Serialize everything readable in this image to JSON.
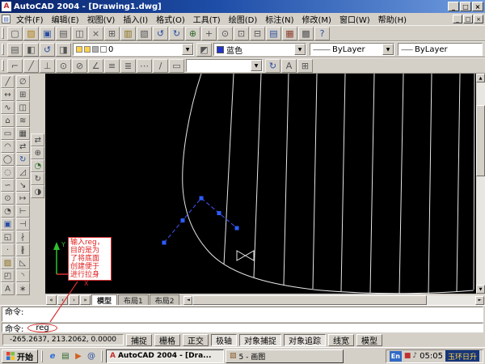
{
  "ui": {
    "dropdown_arrow": "▼",
    "scroll_up": "▲",
    "scroll_down": "▼",
    "scroll_left": "◄",
    "scroll_right": "►"
  },
  "window": {
    "app_icon": "A",
    "title": "AutoCAD 2004 - [Drawing1.dwg]",
    "min": "_",
    "max": "□",
    "close": "×"
  },
  "menu": {
    "items": [
      "文件(F)",
      "编辑(E)",
      "视图(V)",
      "插入(I)",
      "格式(O)",
      "工具(T)",
      "绘图(D)",
      "标注(N)",
      "修改(M)",
      "窗口(W)",
      "帮助(H)"
    ]
  },
  "toolbars": {
    "standard": [
      {
        "n": "new-file-icon",
        "g": "▢",
        "s": "color:#555"
      },
      {
        "n": "open-file-icon",
        "g": "▨",
        "s": "color:#b07d10"
      },
      {
        "n": "save-file-icon",
        "g": "▣",
        "s": "color:#2b4fa0"
      },
      {
        "n": "plot-icon",
        "g": "▤",
        "s": "color:#555"
      },
      {
        "n": "plot-preview-icon",
        "g": "◫",
        "s": "color:#555"
      },
      {
        "n": "cut-icon",
        "g": "×",
        "s": "color:#555"
      },
      {
        "n": "copy-icon",
        "g": "⊞",
        "s": "color:#555"
      },
      {
        "n": "paste-icon",
        "g": "▥",
        "s": "color:#8a6d1a"
      },
      {
        "n": "match-properties-icon",
        "g": "▧",
        "s": "color:#555"
      },
      {
        "n": "undo-icon",
        "g": "↺",
        "s": "color:#2b4fa0"
      },
      {
        "n": "redo-icon",
        "g": "↻",
        "s": "color:#2b4fa0"
      },
      {
        "n": "insert-hyperlink-icon",
        "g": "⊕",
        "s": "color:#2b6a2b"
      },
      {
        "n": "pan-realtime-icon",
        "g": "+",
        "s": "color:#555"
      },
      {
        "n": "zoom-realtime-icon",
        "g": "⊙",
        "s": "color:#555"
      },
      {
        "n": "zoom-window-icon",
        "g": "⊡",
        "s": "color:#555"
      },
      {
        "n": "zoom-previous-icon",
        "g": "⊟",
        "s": "color:#555"
      },
      {
        "n": "properties-icon",
        "g": "▤",
        "s": "color:#2b4fa0"
      },
      {
        "n": "design-center-icon",
        "g": "▦",
        "s": "color:#8a3d2a"
      },
      {
        "n": "tool-palettes-icon",
        "g": "▩",
        "s": "color:#555"
      },
      {
        "n": "help-icon",
        "g": "?",
        "s": "color:#2b4fa0"
      }
    ],
    "properties": {
      "icons": [
        {
          "n": "layer-properties-icon",
          "g": "▤",
          "s": "color:#555"
        },
        {
          "n": "layer-states-icon",
          "g": "◧",
          "s": "color:#555"
        },
        {
          "n": "layer-previous-icon",
          "g": "↺",
          "s": "color:#2b4fa0"
        },
        {
          "n": "make-layer-current-icon",
          "g": "◨",
          "s": "color:#555"
        }
      ],
      "mid_icon": {
        "n": "layer-tools-icon",
        "g": "◩"
      },
      "layer_value": "0",
      "color_value": "蓝色",
      "color_swatch_style": "background:#2233cc",
      "linetype_value": "ByLayer",
      "lineweight_value": "ByLayer"
    },
    "styles": {
      "icons": [
        {
          "n": "linear-dimension-icon",
          "g": "⌐",
          "s": "color:#555"
        },
        {
          "n": "aligned-dimension-icon",
          "g": "╱",
          "s": "color:#555"
        },
        {
          "n": "ordinate-dimension-icon",
          "g": "⊥",
          "s": "color:#555"
        },
        {
          "n": "radius-dimension-icon",
          "g": "⊙",
          "s": "color:#555"
        },
        {
          "n": "diameter-dimension-icon",
          "g": "⊘",
          "s": "color:#555"
        },
        {
          "n": "angular-dimension-icon",
          "g": "∠",
          "s": "color:#555"
        },
        {
          "n": "quick-dimension-icon",
          "g": "≡",
          "s": "color:#555"
        },
        {
          "n": "baseline-dimension-icon",
          "g": "≣",
          "s": "color:#555"
        },
        {
          "n": "continue-dimension-icon",
          "g": "⋯",
          "s": "color:#555"
        },
        {
          "n": "dimension-edit-icon",
          "g": "∕",
          "s": "color:#555"
        },
        {
          "n": "dimension-style-icon",
          "g": "▭",
          "s": "color:#555"
        }
      ],
      "style_value": "",
      "icons_after": [
        {
          "n": "dimension-update-icon",
          "g": "↻",
          "s": "color:#2b4fa0"
        },
        {
          "n": "dimension-text-edit-icon",
          "g": "A",
          "s": "color:#555"
        },
        {
          "n": "tolerance-icon",
          "g": "⊞",
          "s": "color:#555"
        }
      ]
    },
    "draw": [
      {
        "n": "line-icon",
        "g": "╱",
        "s": "color:#444"
      },
      {
        "n": "construction-line-icon",
        "g": "↔",
        "s": "color:#444"
      },
      {
        "n": "polyline-icon",
        "g": "∿",
        "s": "color:#444"
      },
      {
        "n": "polygon-icon",
        "g": "⌂",
        "s": "color:#444"
      },
      {
        "n": "rectangle-icon",
        "g": "▭",
        "s": "color:#444"
      },
      {
        "n": "arc-icon",
        "g": "◠",
        "s": "color:#444"
      },
      {
        "n": "circle-icon",
        "g": "◯",
        "s": "color:#444"
      },
      {
        "n": "revision-cloud-icon",
        "g": "◌",
        "s": "color:#444"
      },
      {
        "n": "spline-icon",
        "g": "∽",
        "s": "color:#444"
      },
      {
        "n": "ellipse-icon",
        "g": "⊙",
        "s": "color:#444"
      },
      {
        "n": "ellipse-arc-icon",
        "g": "◔",
        "s": "color:#444"
      },
      {
        "n": "insert-block-icon",
        "g": "▣",
        "s": "color:#2b4fa0"
      },
      {
        "n": "make-block-icon",
        "g": "◱",
        "s": "color:#444"
      },
      {
        "n": "point-icon",
        "g": "·",
        "s": "color:#444"
      },
      {
        "n": "hatch-icon",
        "g": "▨",
        "s": "color:#8a6d1a"
      },
      {
        "n": "region-icon",
        "g": "◰",
        "s": "color:#444"
      },
      {
        "n": "multiline-text-icon",
        "g": "A",
        "s": "color:#444"
      }
    ],
    "modify": [
      {
        "n": "erase-icon",
        "g": "∅",
        "s": "color:#444"
      },
      {
        "n": "copy-object-icon",
        "g": "⊞",
        "s": "color:#444"
      },
      {
        "n": "mirror-icon",
        "g": "◫",
        "s": "color:#444"
      },
      {
        "n": "offset-icon",
        "g": "≋",
        "s": "color:#444"
      },
      {
        "n": "array-icon",
        "g": "▦",
        "s": "color:#444"
      },
      {
        "n": "move-icon",
        "g": "⇄",
        "s": "color:#444"
      },
      {
        "n": "rotate-icon",
        "g": "↻",
        "s": "color:#2b4fa0"
      },
      {
        "n": "scale-icon",
        "g": "◿",
        "s": "color:#444"
      },
      {
        "n": "stretch-icon",
        "g": "↘",
        "s": "color:#444"
      },
      {
        "n": "lengthen-icon",
        "g": "↦",
        "s": "color:#444"
      },
      {
        "n": "trim-icon",
        "g": "⊢",
        "s": "color:#444"
      },
      {
        "n": "extend-icon",
        "g": "⊣",
        "s": "color:#444"
      },
      {
        "n": "break-at-point-icon",
        "g": "∤",
        "s": "color:#444"
      },
      {
        "n": "break-icon",
        "g": "∦",
        "s": "color:#444"
      },
      {
        "n": "chamfer-icon",
        "g": "◺",
        "s": "color:#444"
      },
      {
        "n": "fillet-icon",
        "g": "◝",
        "s": "color:#444"
      },
      {
        "n": "explode-icon",
        "g": "∗",
        "s": "color:#444"
      }
    ],
    "orbit": [
      {
        "n": "pan-3d-icon",
        "g": "⇄",
        "s": "color:#444"
      },
      {
        "n": "zoom-3d-icon",
        "g": "⊕",
        "s": "color:#444"
      },
      {
        "n": "orbit-3d-icon",
        "g": "◔",
        "s": "color:#2b6a2b"
      },
      {
        "n": "continuous-orbit-icon",
        "g": "↻",
        "s": "color:#444"
      },
      {
        "n": "swivel-3d-icon",
        "g": "◑",
        "s": "color:#444"
      }
    ]
  },
  "viewport": {
    "annotation_lines": [
      "输入reg，",
      "目的是为",
      "了将底面",
      "创建便于",
      "进行拉身"
    ],
    "annotation_color": "#e02020"
  },
  "tabs": {
    "nav": [
      {
        "n": "tab-nav-first",
        "g": "«"
      },
      {
        "n": "tab-nav-prev",
        "g": "‹"
      },
      {
        "n": "tab-nav-next",
        "g": "›"
      },
      {
        "n": "tab-nav-last",
        "g": "»"
      }
    ],
    "items": [
      {
        "label": "模型",
        "active": true
      },
      {
        "label": "布局1",
        "active": false
      },
      {
        "label": "布局2",
        "active": false
      }
    ]
  },
  "command": {
    "history": [
      "命令:"
    ],
    "prompt": "命令:",
    "input": "reg"
  },
  "status": {
    "coords": "-265.2637, 213.2062, 0.0000",
    "buttons": [
      {
        "label": "捕捉",
        "pressed": false
      },
      {
        "label": "栅格",
        "pressed": false
      },
      {
        "label": "正交",
        "pressed": false
      },
      {
        "label": "极轴",
        "pressed": true
      },
      {
        "label": "对象捕捉",
        "pressed": true
      },
      {
        "label": "对象追踪",
        "pressed": true
      },
      {
        "label": "线宽",
        "pressed": false
      },
      {
        "label": "模型",
        "pressed": false
      }
    ]
  },
  "taskbar": {
    "start_label": "开始",
    "quick_launch": [
      {
        "n": "ie-icon",
        "g": "e",
        "s": "color:#2e6fd8;font-style:italic;font-weight:bold"
      },
      {
        "n": "show-desktop-icon",
        "g": "▤",
        "s": "color:#2b6a2b"
      },
      {
        "n": "media-player-icon",
        "g": "▶",
        "s": "color:#d06020"
      },
      {
        "n": "outlook-icon",
        "g": "@",
        "s": "color:#2b4fa0"
      }
    ],
    "tasks": [
      {
        "label": "AutoCAD 2004 - [Dra...",
        "active": true,
        "icon": "A",
        "ic": "color:#c03030;font-weight:bold"
      },
      {
        "label": "5 - 画图",
        "active": false,
        "icon": "▨",
        "ic": "color:#8a5d2a"
      }
    ],
    "tray": {
      "lang": "En",
      "icons": [
        {
          "n": "antivirus-icon",
          "g": "■",
          "s": "color:#c03030"
        },
        {
          "n": "volume-icon",
          "g": "♪",
          "s": "color:#444"
        }
      ],
      "time": "05:05",
      "watermark": "玉环日升"
    }
  }
}
